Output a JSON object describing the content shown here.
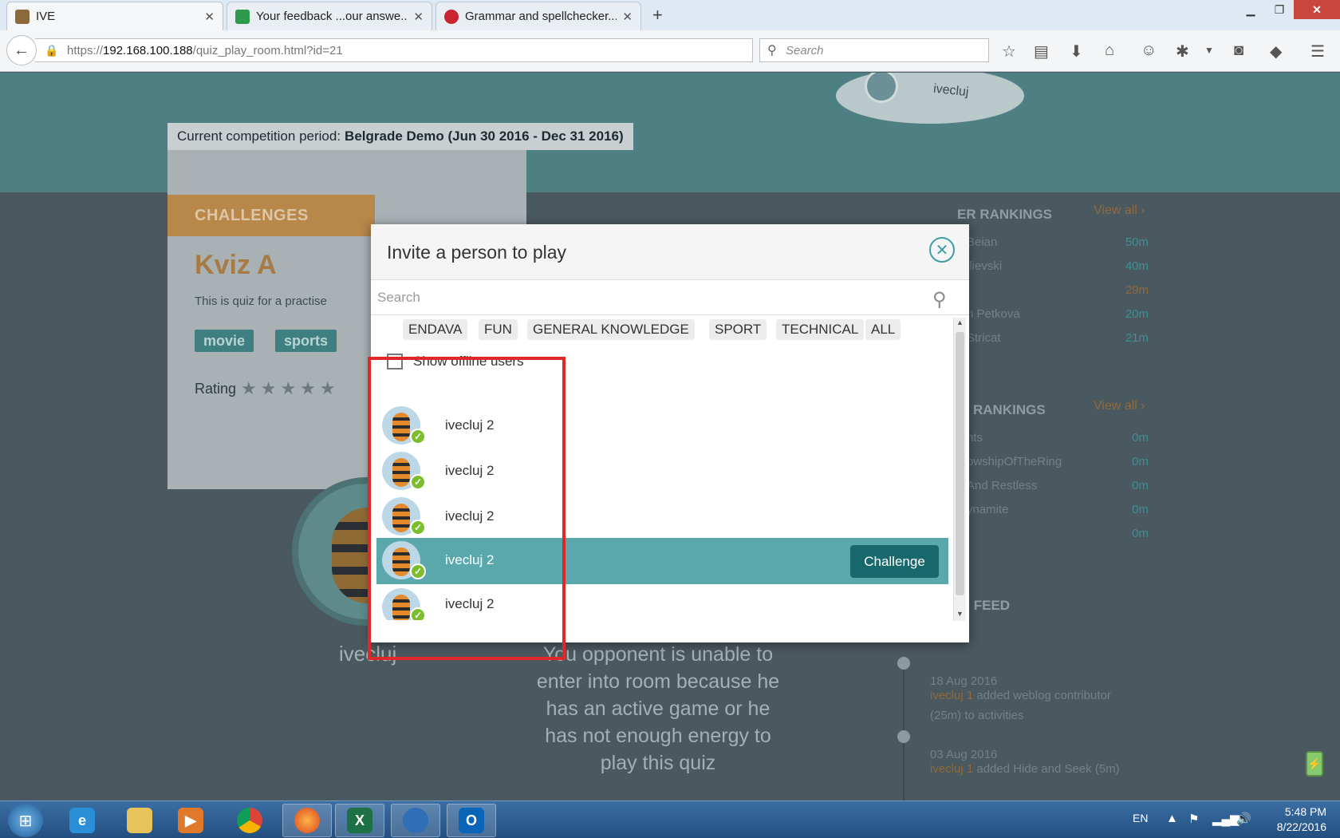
{
  "browser": {
    "tabs": [
      {
        "label": "IVE",
        "active": true
      },
      {
        "label": "Your feedback ...our answe...",
        "active": false
      },
      {
        "label": "Grammar and spellchecker...",
        "active": false
      }
    ],
    "new_tab_icon": "plus-icon",
    "url_prefix": "https://",
    "url_host": "192.168.100.188",
    "url_path": "/quiz_play_room.html?id=21",
    "search_placeholder": "Search"
  },
  "page": {
    "avatar_user": "ivecluj",
    "period_label": "Current competition period:",
    "period_value": "Belgrade Demo (Jun 30 2016 - Dec 31 2016)",
    "challenges_heading": "CHALLENGES",
    "quiz_title": "Kviz A",
    "quiz_description": "This is quiz for a practise",
    "tags": [
      "movie",
      "sports"
    ],
    "rating_label": "Rating",
    "player_name": "ivecluj",
    "opponent_message": "You opponent is unable to enter into room because he has an active game or he has not enough energy to play this quiz"
  },
  "rankings": {
    "player_heading": "ER RANKINGS",
    "view_all": "View all ›",
    "player_rows": [
      {
        "name": "Beian",
        "value": "50m"
      },
      {
        "name": "llievski",
        "value": "40m"
      },
      {
        "name": "",
        "value": "29m"
      },
      {
        "name": "n Petkova",
        "value": "20m"
      },
      {
        "name": "Stricat",
        "value": "21m"
      }
    ],
    "team_heading": "RANKINGS",
    "team_rows": [
      {
        "name": "hts",
        "value": "0m"
      },
      {
        "name": "owshipOfTheRing",
        "value": "0m"
      },
      {
        "name": "And Restless",
        "value": "0m"
      },
      {
        "name": "ynamite",
        "value": "0m"
      },
      {
        "name": "",
        "value": "0m"
      }
    ]
  },
  "news_feed": {
    "heading": "NEWS FEED",
    "items": [
      {
        "date": "18 Aug 2016",
        "user": "ivecluj 1",
        "text": " added weblog contributor (25m) to activities"
      },
      {
        "date": "03 Aug 2016",
        "user": "ivecluj 1",
        "text": " added Hide and Seek (5m)"
      }
    ]
  },
  "modal": {
    "title": "Invite a person to play",
    "search_placeholder": "Search",
    "categories": [
      "ENDAVA",
      "FUN",
      "GENERAL KNOWLEDGE",
      "SPORT",
      "TECHNICAL",
      "ALL"
    ],
    "show_offline_label": "Show offline users",
    "users": [
      {
        "name": "ivecluj 2",
        "online": true,
        "selected": false
      },
      {
        "name": "ivecluj 2",
        "online": true,
        "selected": false
      },
      {
        "name": "ivecluj 2",
        "online": true,
        "selected": false
      },
      {
        "name": "ivecluj 2",
        "online": true,
        "selected": true
      },
      {
        "name": "ivecluj 2",
        "online": true,
        "selected": false
      }
    ],
    "challenge_button": "Challenge"
  },
  "taskbar": {
    "language": "EN",
    "time": "5:48 PM",
    "date": "8/22/2016"
  },
  "colors": {
    "accent_teal": "#5aa8ac",
    "challenge_button": "#17696d",
    "highlight_red": "#e02828",
    "brand_orange": "#b8874a"
  }
}
